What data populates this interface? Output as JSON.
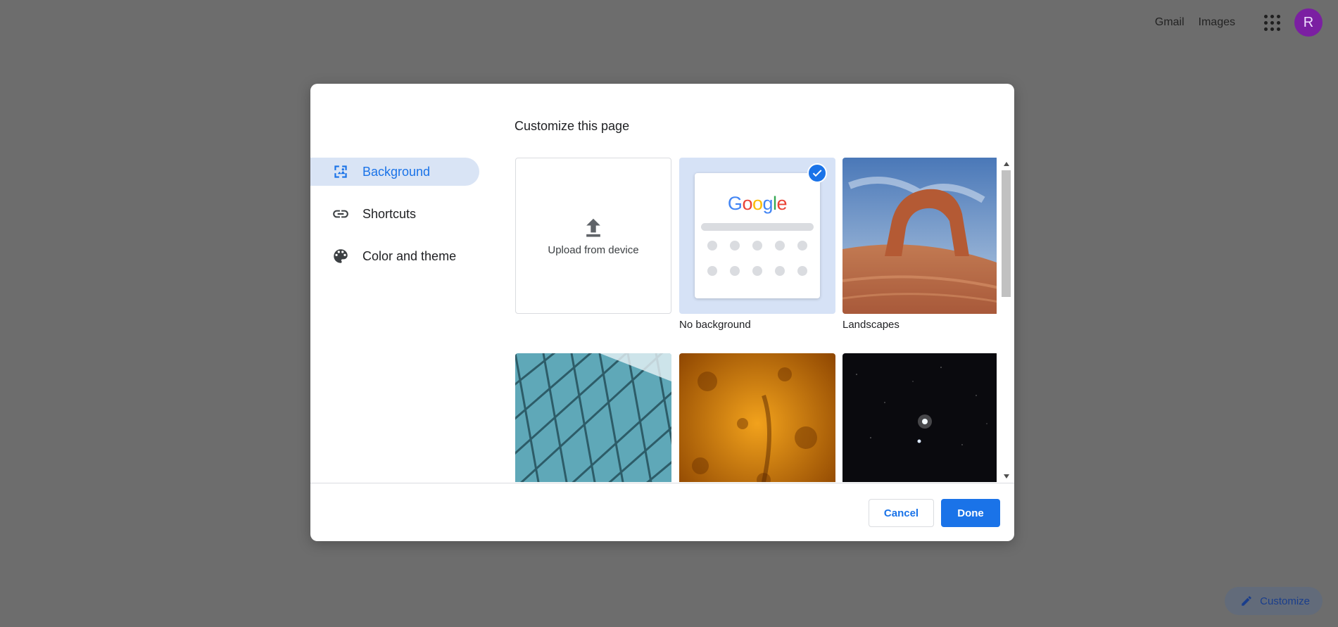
{
  "topbar": {
    "gmail_label": "Gmail",
    "images_label": "Images",
    "avatar_letter": "R",
    "avatar_color": "#7b1fa2"
  },
  "customize_pill": {
    "label": "Customize",
    "icon": "pencil-icon"
  },
  "dialog": {
    "title": "Customize this page",
    "nav": [
      {
        "label": "Background",
        "icon": "image-icon",
        "active": true
      },
      {
        "label": "Shortcuts",
        "icon": "link-icon",
        "active": false
      },
      {
        "label": "Color and theme",
        "icon": "palette-icon",
        "active": false
      }
    ],
    "tiles": [
      {
        "label": "",
        "text": "Upload from device",
        "type": "upload"
      },
      {
        "label": "No background",
        "type": "no-background",
        "selected": true,
        "google_word": "Google"
      },
      {
        "label": "Landscapes",
        "type": "image",
        "scene": "desert-arch"
      },
      {
        "label": "",
        "type": "image",
        "scene": "glass-building"
      },
      {
        "label": "",
        "type": "image",
        "scene": "orange-texture"
      },
      {
        "label": "",
        "type": "image",
        "scene": "space-planet"
      }
    ],
    "footer": {
      "cancel_label": "Cancel",
      "done_label": "Done"
    }
  },
  "colors": {
    "accent": "#1a73e8",
    "nav_active_bg": "#d9e4f5",
    "overlay": "#6d6d6d"
  }
}
